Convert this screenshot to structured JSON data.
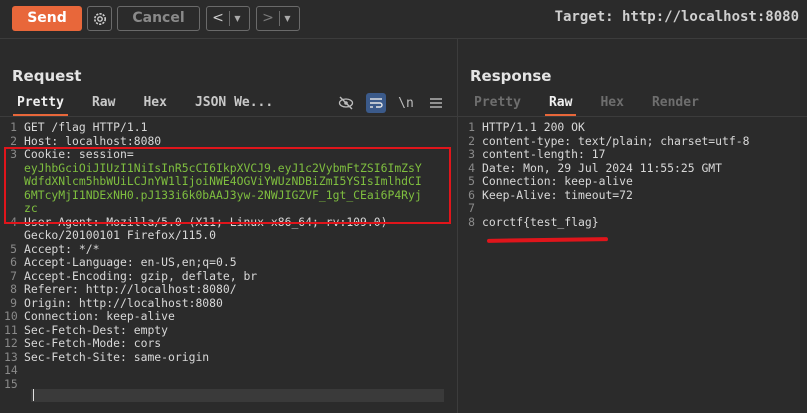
{
  "toolbar": {
    "send_label": "Send",
    "cancel_label": "Cancel",
    "back_symbol": "<",
    "forward_symbol": ">",
    "dropdown_symbol": "▼",
    "target_text": "Target: http://localhost:8080"
  },
  "request": {
    "title": "Request",
    "tabs": [
      "Pretty",
      "Raw",
      "Hex",
      "JSON We..."
    ],
    "active_tab": "Pretty",
    "wrap_symbol": "\\n",
    "lines": [
      {
        "n": "1",
        "t": "GET /flag HTTP/1.1"
      },
      {
        "n": "2",
        "t": "Host: localhost:8080"
      },
      {
        "n": "3",
        "t": "Cookie: session="
      },
      {
        "n": "",
        "t": "eyJhbGciOiJIUzI1NiIsInR5cCI6IkpXVCJ9.eyJ1c2VybmFtZSI6ImZsY"
      },
      {
        "n": "",
        "t": "WdfdXNlcm5hbWUiLCJnYW1lIjoiNWE4OGViYWUzNDBiZmI5YSIsImlhdCI"
      },
      {
        "n": "",
        "t": "6MTcyMjI1NDExNH0.pJ133i6k0bAAJ3yw-2NWJIGZVF_1gt_CEai6P4Ryj"
      },
      {
        "n": "",
        "t": "zc"
      },
      {
        "n": "4",
        "t": "User-Agent: Mozilla/5.0 (X11; Linux x86_64; rv:109.0)"
      },
      {
        "n": "",
        "t": "Gecko/20100101 Firefox/115.0"
      },
      {
        "n": "5",
        "t": "Accept: */*"
      },
      {
        "n": "6",
        "t": "Accept-Language: en-US,en;q=0.5"
      },
      {
        "n": "7",
        "t": "Accept-Encoding: gzip, deflate, br"
      },
      {
        "n": "8",
        "t": "Referer: http://localhost:8080/"
      },
      {
        "n": "9",
        "t": "Origin: http://localhost:8080"
      },
      {
        "n": "10",
        "t": "Connection: keep-alive"
      },
      {
        "n": "11",
        "t": "Sec-Fetch-Dest: empty"
      },
      {
        "n": "12",
        "t": "Sec-Fetch-Mode: cors"
      },
      {
        "n": "13",
        "t": "Sec-Fetch-Site: same-origin"
      },
      {
        "n": "14",
        "t": ""
      },
      {
        "n": "15",
        "t": ""
      }
    ]
  },
  "response": {
    "title": "Response",
    "tabs": [
      "Pretty",
      "Raw",
      "Hex",
      "Render"
    ],
    "active_tab": "Raw",
    "lines": [
      {
        "n": "1",
        "t": "HTTP/1.1 200 OK"
      },
      {
        "n": "2",
        "t": "content-type: text/plain; charset=utf-8"
      },
      {
        "n": "3",
        "t": "content-length: 17"
      },
      {
        "n": "4",
        "t": "Date: Mon, 29 Jul 2024 11:55:25 GMT"
      },
      {
        "n": "5",
        "t": "Connection: keep-alive"
      },
      {
        "n": "6",
        "t": "Keep-Alive: timeout=72"
      },
      {
        "n": "7",
        "t": ""
      },
      {
        "n": "8",
        "t": "corctf{test_flag}"
      }
    ]
  },
  "colors": {
    "accent": "#e8673a",
    "highlight": "#e0151b",
    "token": "#7fbf3f"
  }
}
